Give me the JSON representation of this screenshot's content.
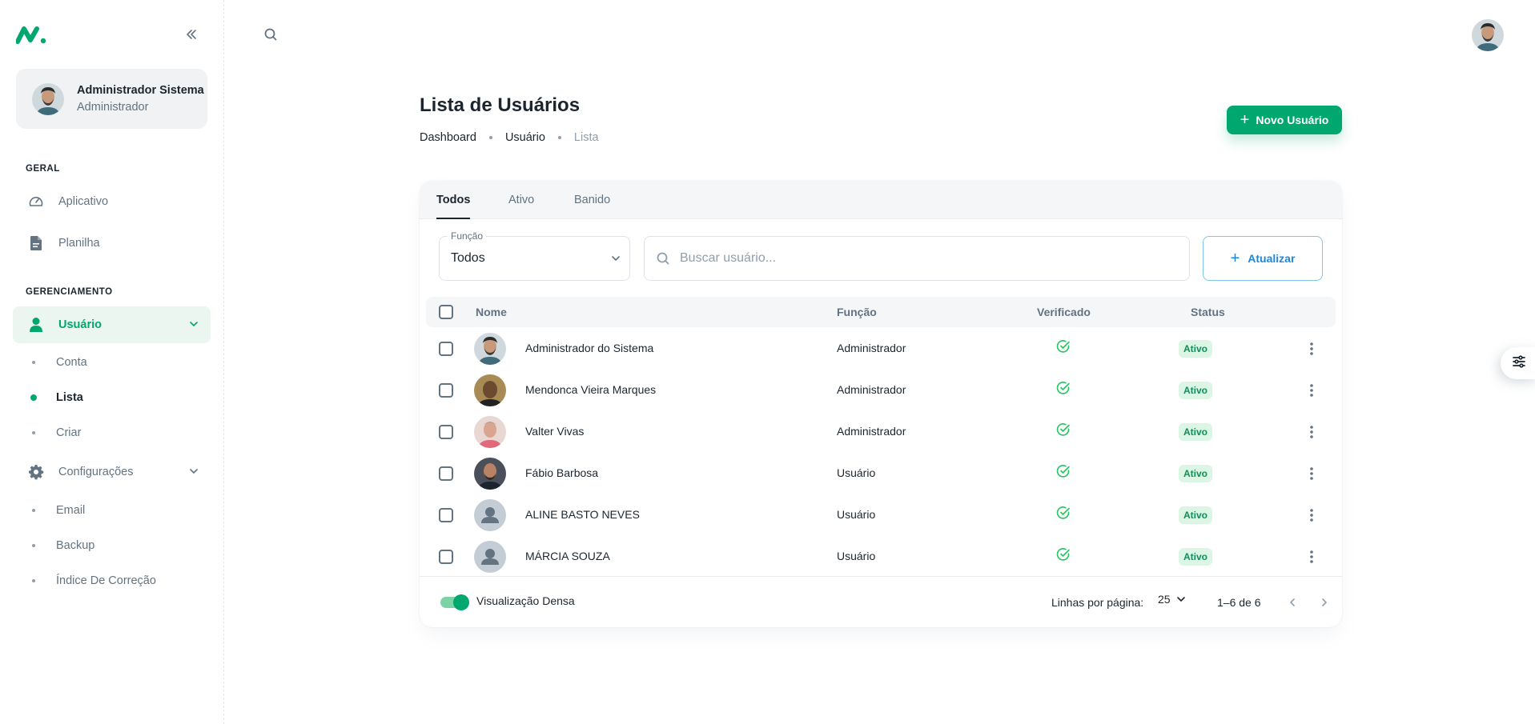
{
  "sidebar": {
    "account": {
      "name": "Administrador Sistema",
      "role": "Administrador"
    },
    "sections": {
      "general": "GERAL",
      "management": "GERENCIAMENTO"
    },
    "items": {
      "app": "Aplicativo",
      "sheet": "Planilha",
      "user": "Usuário",
      "user_sub": [
        "Conta",
        "Lista",
        "Criar"
      ],
      "settings": "Configurações",
      "settings_sub": [
        "Email",
        "Backup",
        "Índice De Correção"
      ]
    }
  },
  "page": {
    "title": "Lista de Usuários",
    "breadcrumb": [
      "Dashboard",
      "Usuário",
      "Lista"
    ],
    "new_user_label": "Novo Usuário"
  },
  "tabs": [
    "Todos",
    "Ativo",
    "Banido"
  ],
  "filters": {
    "role_legend": "Função",
    "role_value": "Todos",
    "search_placeholder": "Buscar usuário...",
    "refresh_label": "Atualizar"
  },
  "table": {
    "headers": {
      "name": "Nome",
      "role": "Função",
      "verified": "Verificado",
      "status": "Status"
    },
    "rows": [
      {
        "name": "Administrador do Sistema",
        "role": "Administrador",
        "status": "Ativo",
        "avatar": "photo-1"
      },
      {
        "name": "Mendonca Vieira Marques",
        "role": "Administrador",
        "status": "Ativo",
        "avatar": "photo-2"
      },
      {
        "name": "Valter Vivas",
        "role": "Administrador",
        "status": "Ativo",
        "avatar": "photo-3"
      },
      {
        "name": "Fábio Barbosa",
        "role": "Usuário",
        "status": "Ativo",
        "avatar": "photo-4"
      },
      {
        "name": "ALINE BASTO NEVES",
        "role": "Usuário",
        "status": "Ativo",
        "avatar": "placeholder"
      },
      {
        "name": "MÁRCIA SOUZA",
        "role": "Usuário",
        "status": "Ativo",
        "avatar": "placeholder"
      }
    ]
  },
  "footer": {
    "dense_label": "Visualização Densa",
    "rows_per_page_label": "Linhas por página:",
    "rows_per_page_value": "25",
    "range": "1–6 de 6"
  },
  "colors": {
    "primary": "#00a76f",
    "info": "#1e88d9",
    "badge_bg": "#dbf6e5",
    "badge_text": "#118d57"
  }
}
